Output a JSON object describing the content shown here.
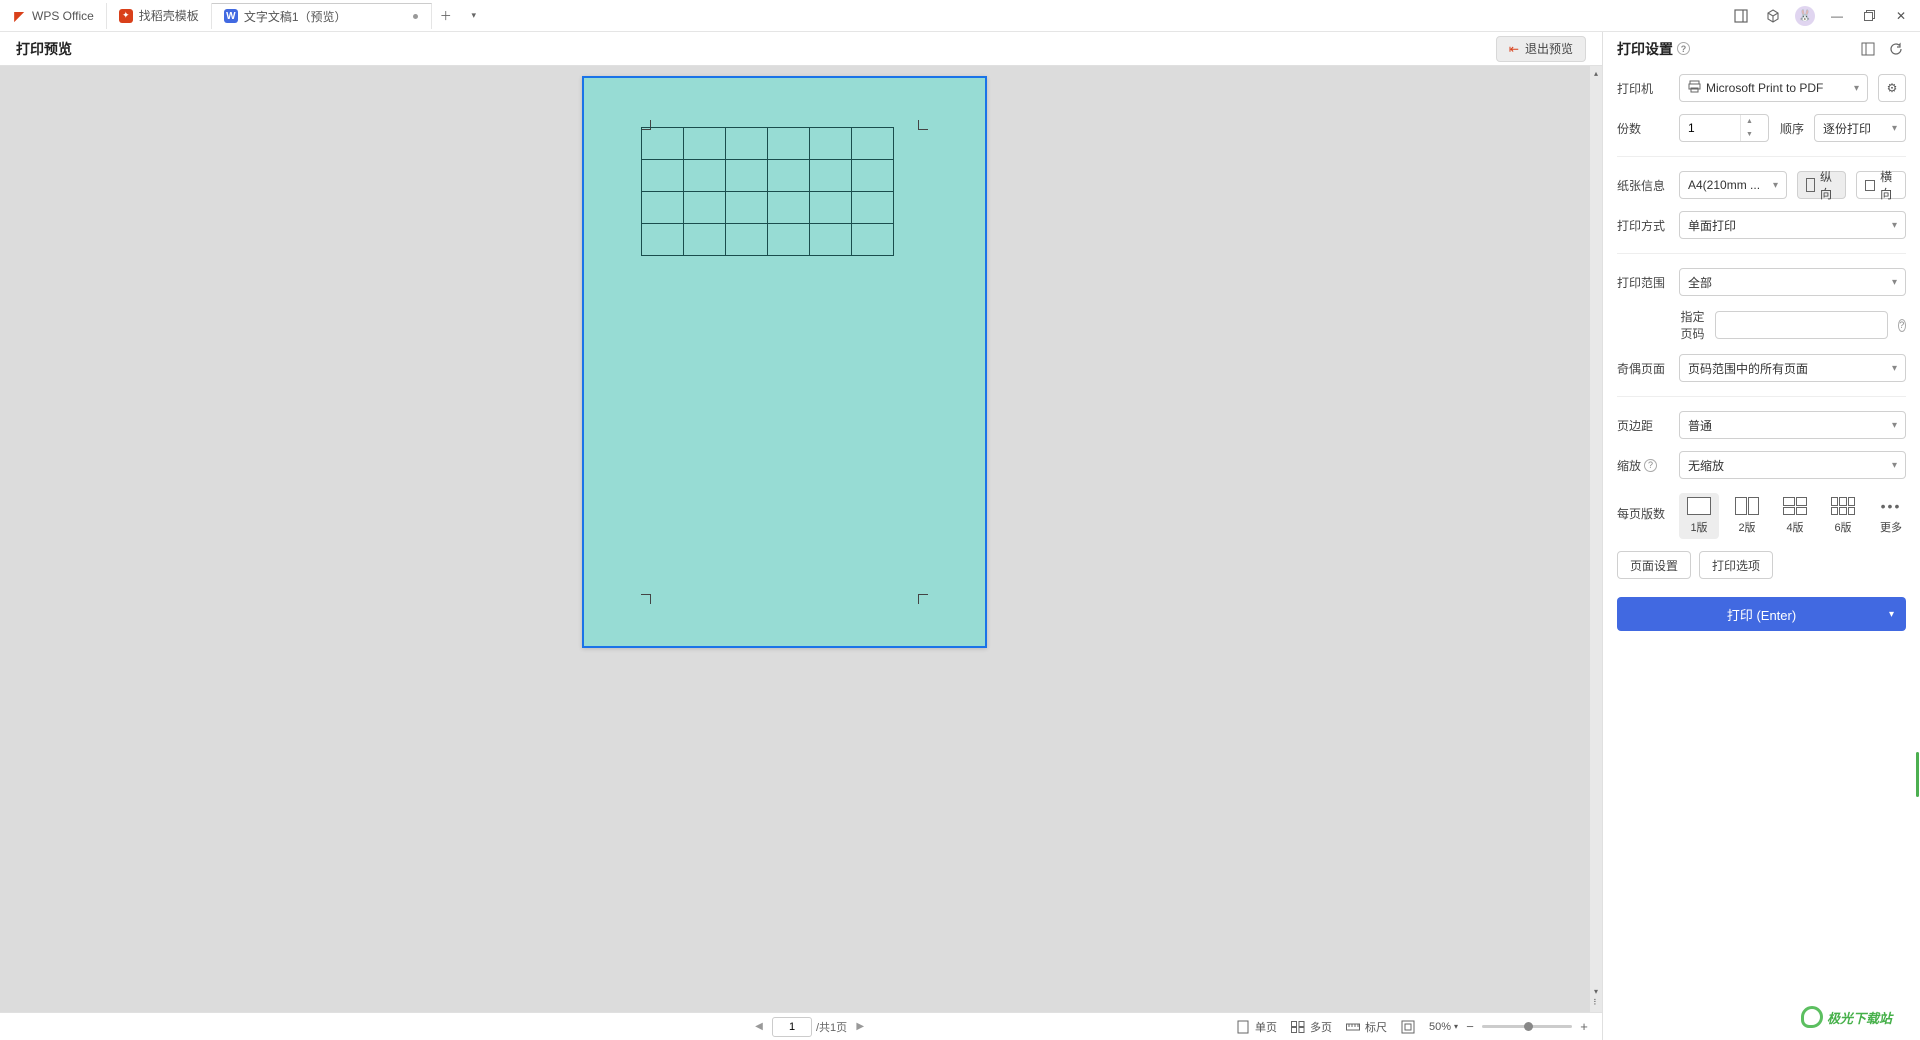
{
  "titlebar": {
    "app_name": "WPS Office",
    "template_tab": "找稻壳模板",
    "doc_tab": "文字文稿1（预览）"
  },
  "preview": {
    "title": "打印预览",
    "exit": "退出预览"
  },
  "statusbar": {
    "page_current": "1",
    "page_total": "/共1页",
    "single": "单页",
    "multi": "多页",
    "ruler": "标尺",
    "zoom": "50%"
  },
  "settings": {
    "title": "打印设置",
    "printer_label": "打印机",
    "printer_value": "Microsoft Print to PDF",
    "copies_label": "份数",
    "copies_value": "1",
    "order_label": "顺序",
    "order_value": "逐份打印",
    "paper_label": "纸张信息",
    "paper_value": "A4(210mm ...",
    "portrait": "纵向",
    "landscape": "横向",
    "duplex_label": "打印方式",
    "duplex_value": "单面打印",
    "range_label": "打印范围",
    "range_value": "全部",
    "specify_pages": "指定页码",
    "oddeven_label": "奇偶页面",
    "oddeven_value": "页码范围中的所有页面",
    "margin_label": "页边距",
    "margin_value": "普通",
    "scale_label": "缩放",
    "scale_value": "无缩放",
    "per_page_label": "每页版数",
    "opt1": "1版",
    "opt2": "2版",
    "opt4": "4版",
    "opt8": "6版",
    "more": "更多",
    "page_setup": "页面设置",
    "print_options": "打印选项",
    "print_btn": "打印 (Enter)"
  },
  "watermark": {
    "name": "极光下载站"
  }
}
